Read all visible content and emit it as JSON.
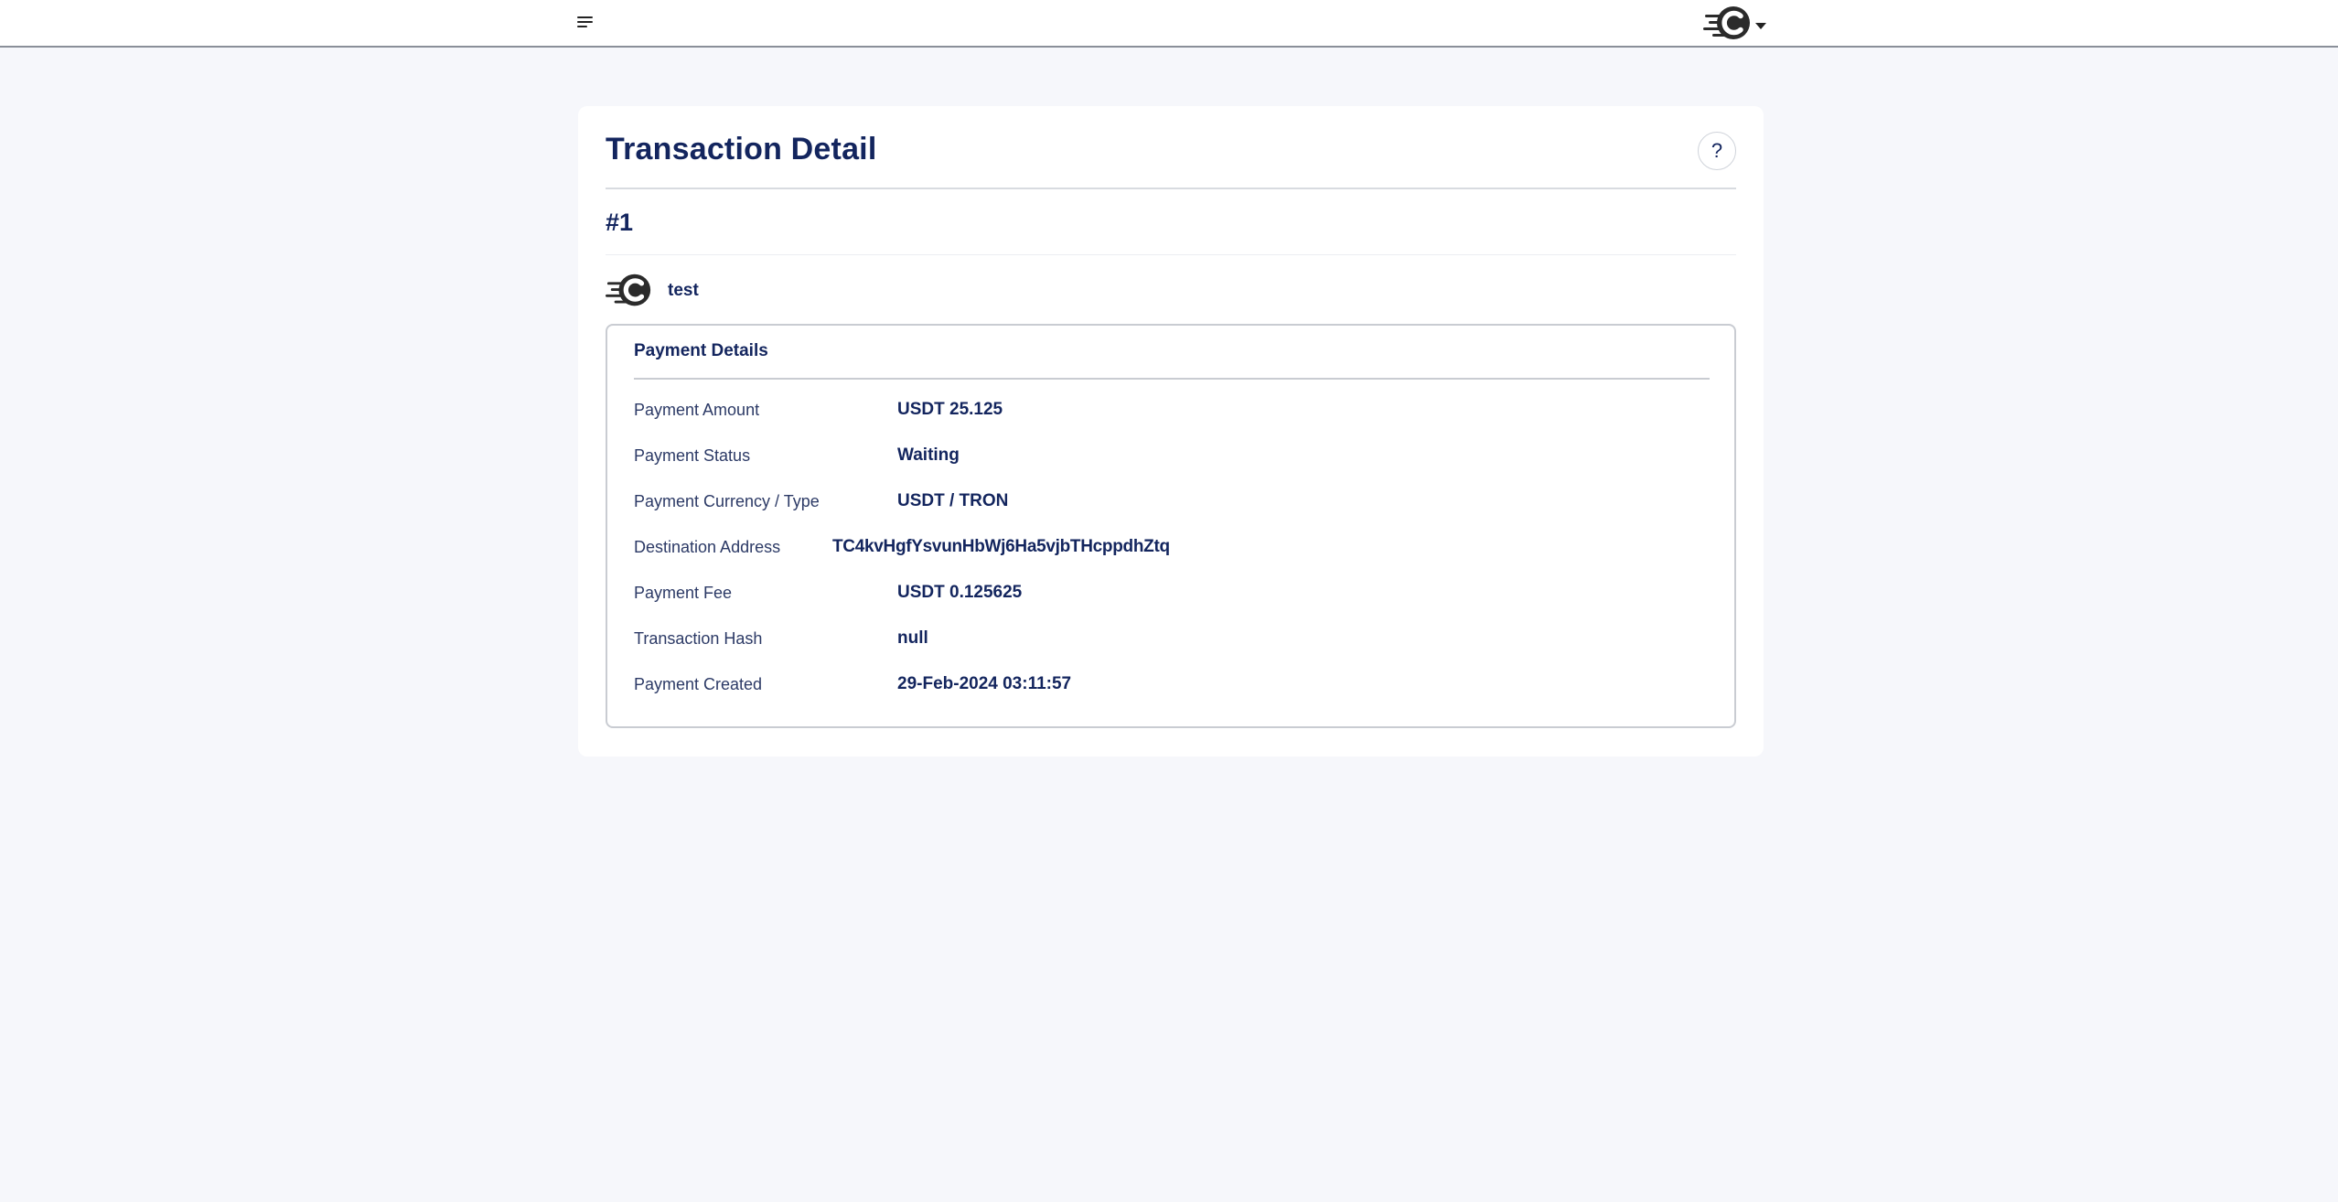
{
  "navbar": {
    "menu_icon": "hamburger-menu-icon",
    "logo_icon": "coin-logo-icon",
    "dropdown_icon": "caret-down-icon"
  },
  "page": {
    "title": "Transaction Detail",
    "help_label": "?",
    "transaction_number": "#1",
    "merchant_name": "test"
  },
  "payment_details": {
    "title": "Payment Details",
    "rows": [
      {
        "label": "Payment Amount",
        "value": "USDT 25.125"
      },
      {
        "label": "Payment Status",
        "value": "Waiting"
      },
      {
        "label": "Payment Currency / Type",
        "value": "USDT / TRON"
      },
      {
        "label": "Destination Address",
        "value": "TC4kvHgfYsvunHbWj6Ha5vjbTHcppdhZtq"
      },
      {
        "label": "Payment Fee",
        "value": "USDT 0.125625"
      },
      {
        "label": "Transaction Hash",
        "value": "null"
      },
      {
        "label": "Payment Created",
        "value": "29-Feb-2024 03:11:57"
      }
    ]
  },
  "colors": {
    "primary_text": "#13255e",
    "background": "#f6f7fb",
    "card": "#ffffff",
    "border": "#c9ccd2"
  }
}
